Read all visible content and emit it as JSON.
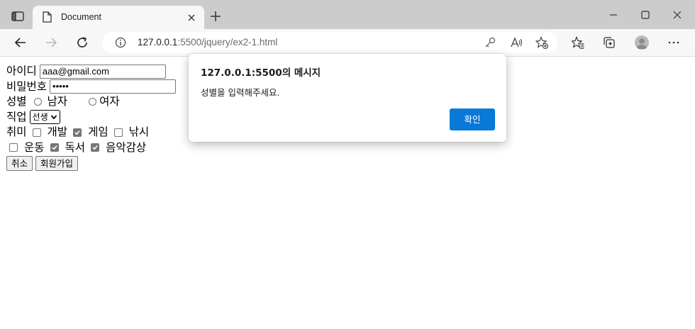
{
  "browser": {
    "tab": {
      "title": "Document"
    },
    "address_bar": {
      "host": "127.0.0.1",
      "path": ":5500/jquery/ex2-1.html"
    }
  },
  "form": {
    "id": {
      "label": "아이디",
      "value": "aaa@gmail.com"
    },
    "password": {
      "label": "비밀번호",
      "value": "•••••"
    },
    "gender": {
      "label": "성별",
      "options": [
        "남자",
        "여자"
      ]
    },
    "job": {
      "label": "직업",
      "selected": "선생"
    },
    "hobby": {
      "label": "취미",
      "options": [
        {
          "label": "개발",
          "checked": false
        },
        {
          "label": "게임",
          "checked": true
        },
        {
          "label": "낚시",
          "checked": false
        },
        {
          "label": "운동",
          "checked": false
        },
        {
          "label": "독서",
          "checked": true
        },
        {
          "label": "음악감상",
          "checked": true
        }
      ]
    },
    "buttons": {
      "cancel": "취소",
      "signup": "회원가입"
    }
  },
  "dialog": {
    "title": "127.0.0.1:5500의 메시지",
    "message": "성별을 입력해주세요.",
    "ok_label": "확인"
  },
  "colors": {
    "accent": "#0a78d7",
    "tabstrip": "#cccccc",
    "toolbar": "#f7f7f7"
  },
  "icons": [
    "tab-actions-icon",
    "document-icon",
    "close-icon",
    "plus-icon",
    "minimize-icon",
    "maximize-icon",
    "close-window-icon",
    "back-icon",
    "forward-icon",
    "refresh-icon",
    "info-icon",
    "key-icon",
    "read-aloud-icon",
    "add-favorite-icon",
    "favorites-icon",
    "collections-icon",
    "profile-icon",
    "more-icon"
  ]
}
